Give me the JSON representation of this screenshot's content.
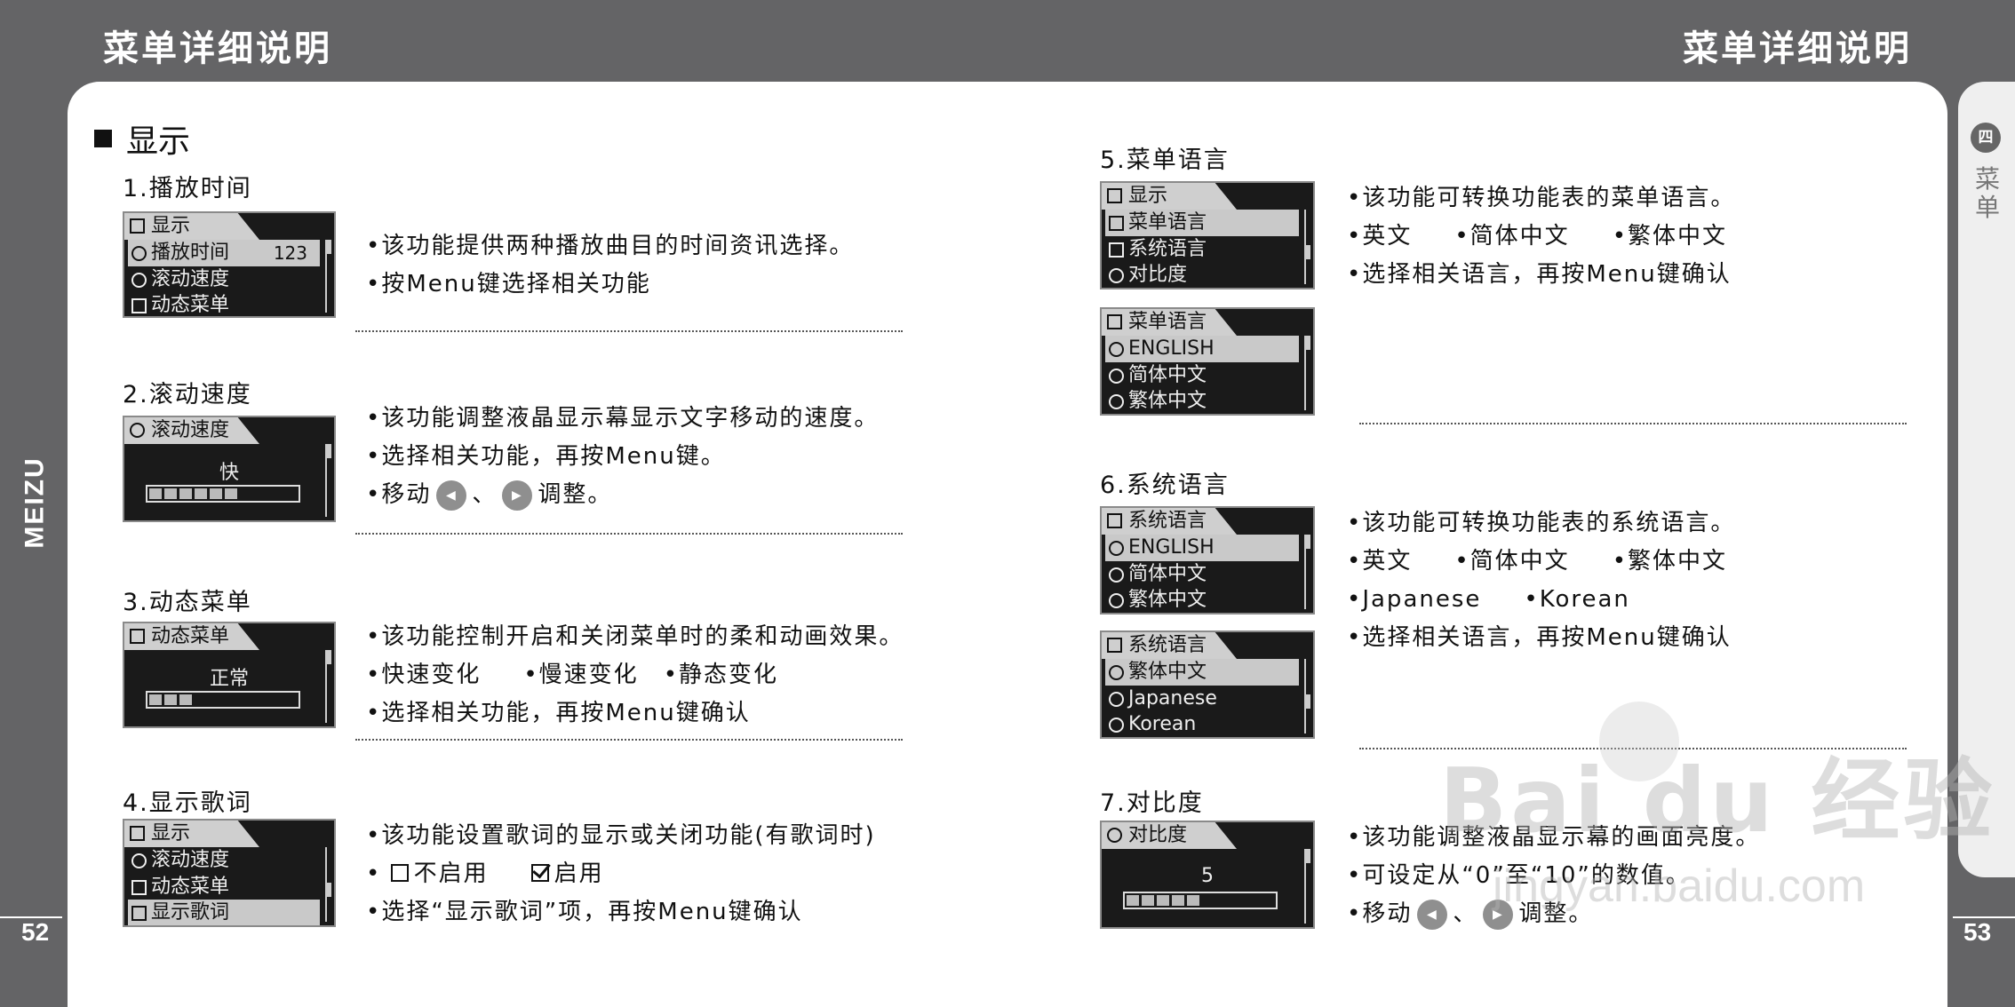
{
  "header": {
    "left_title": "菜单详细说明",
    "right_title": "菜单详细说明"
  },
  "brand": "MEIZU",
  "page_numbers": {
    "left": "52",
    "right": "53"
  },
  "right_tab": {
    "badge": "四",
    "label": "菜单"
  },
  "section": {
    "title": "显示"
  },
  "items": [
    {
      "heading": "1.播放时间",
      "screen": {
        "title": "显示",
        "rows": [
          "播放时间",
          "滚动速度",
          "动态菜单"
        ],
        "value": "123"
      },
      "bullets": [
        "•该功能提供两种播放曲目的时间资讯选择。",
        "•按Menu键选择相关功能"
      ]
    },
    {
      "heading": "2.滚动速度",
      "screen": {
        "title": "滚动速度",
        "center": "快"
      },
      "bullets": [
        "•该功能调整液晶显示幕显示文字移动的速度。",
        "•选择相关功能，再按Menu键。"
      ],
      "move": {
        "prefix": "•移动",
        "sep": "、",
        "suffix": "调整。"
      }
    },
    {
      "heading": "3.动态菜单",
      "screen": {
        "title": "动态菜单",
        "center": "正常"
      },
      "bullets": [
        "•该功能控制开启和关闭菜单时的柔和动画效果。",
        "•选择相关功能，再按Menu键确认"
      ],
      "options": [
        "•快速变化",
        "•慢速变化",
        "•静态变化"
      ]
    },
    {
      "heading": "4.显示歌词",
      "screen": {
        "title": "显示",
        "rows": [
          "滚动速度",
          "动态菜单",
          "显示歌词"
        ]
      },
      "bullets": [
        "•该功能设置歌词的显示或关闭功能(有歌词时)",
        "•选择“显示歌词”项，再按Menu键确认"
      ],
      "checks": {
        "prefix": "•",
        "off": "不启用",
        "on": "启用"
      }
    },
    {
      "heading": "5.菜单语言",
      "screen1": {
        "title": "显示",
        "rows": [
          "菜单语言",
          "系统语言",
          "对比度"
        ]
      },
      "screen2": {
        "title": "菜单语言",
        "rows": [
          "ENGLISH",
          "简体中文",
          "繁体中文"
        ]
      },
      "bullets": [
        "•该功能可转换功能表的菜单语言。",
        "•选择相关语言，再按Menu键确认"
      ],
      "options": [
        "•英文",
        "•简体中文",
        "•繁体中文"
      ]
    },
    {
      "heading": "6.系统语言",
      "screen1": {
        "title": "系统语言",
        "rows": [
          "ENGLISH",
          "简体中文",
          "繁体中文"
        ]
      },
      "screen2": {
        "title": "系统语言",
        "rows": [
          "繁体中文",
          "Japanese",
          "Korean"
        ]
      },
      "bullets": [
        "•该功能可转换功能表的系统语言。",
        "•选择相关语言，再按Menu键确认"
      ],
      "options": [
        "•英文",
        "•简体中文",
        "•繁体中文"
      ],
      "options2": [
        "•Japanese",
        "•Korean"
      ]
    },
    {
      "heading": "7.对比度",
      "screen": {
        "title": "对比度",
        "center": "5"
      },
      "bullets": [
        "•该功能调整液晶显示幕的画面亮度。",
        "•可设定从“0”至“10”的数值。"
      ],
      "move": {
        "prefix": "•移动",
        "sep": "、",
        "suffix": "调整。"
      }
    }
  ],
  "icons": {
    "prev_button": "prev-track-icon",
    "next_button": "next-track-icon"
  },
  "watermark": {
    "text": "Bai du 经验",
    "url": "jingyan.baidu.com"
  }
}
